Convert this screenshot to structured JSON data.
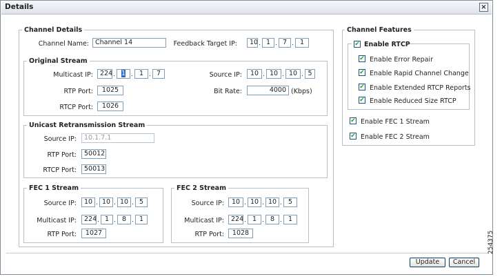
{
  "dialog": {
    "title": "Details",
    "close_glyph": "×"
  },
  "channel_details": {
    "legend": "Channel Details",
    "channel_name_label": "Channel Name:",
    "channel_name": "Channel 14",
    "feedback_label": "Feedback Target IP:",
    "feedback_ip": [
      "10",
      "1",
      "7",
      "1"
    ]
  },
  "original_stream": {
    "legend": "Original Stream",
    "multicast_label": "Multicast IP:",
    "multicast_ip": [
      "224",
      "1",
      "1",
      "7"
    ],
    "source_label": "Source IP:",
    "source_ip": [
      "10",
      "10",
      "10",
      "5"
    ],
    "rtp_label": "RTP Port:",
    "rtp_port": "1025",
    "bitrate_label": "Bit Rate:",
    "bitrate": "4000",
    "bitrate_unit": "(Kbps)",
    "rtcp_label": "RTCP Port:",
    "rtcp_port": "1026"
  },
  "unicast_stream": {
    "legend": "Unicast Retransmission Stream",
    "source_label": "Source IP:",
    "source_ip": "10.1.7.1",
    "rtp_label": "RTP Port:",
    "rtp_port": "50012",
    "rtcp_label": "RTCP Port:",
    "rtcp_port": "50013"
  },
  "fec1": {
    "legend": "FEC 1 Stream",
    "source_label": "Source IP:",
    "source_ip": [
      "10",
      "10",
      "10",
      "5"
    ],
    "multicast_label": "Multicast IP:",
    "multicast_ip": [
      "224",
      "1",
      "8",
      "1"
    ],
    "rtp_label": "RTP Port:",
    "rtp_port": "1027"
  },
  "fec2": {
    "legend": "FEC 2 Stream",
    "source_label": "Source IP:",
    "source_ip": [
      "10",
      "10",
      "10",
      "5"
    ],
    "multicast_label": "Multicast IP:",
    "multicast_ip": [
      "224",
      "1",
      "8",
      "1"
    ],
    "rtp_label": "RTP Port:",
    "rtp_port": "1028"
  },
  "channel_features": {
    "legend": "Channel Features",
    "enable_rtcp": {
      "label": "Enable RTCP",
      "checked": true
    },
    "rtcp_options": [
      {
        "label": "Enable Error Repair",
        "checked": true
      },
      {
        "label": "Enable Rapid Channel Change",
        "checked": true
      },
      {
        "label": "Enable Extended RTCP Reports",
        "checked": true
      },
      {
        "label": "Enable Reduced Size RTCP",
        "checked": true
      }
    ],
    "fec1": {
      "label": "Enable FEC 1 Stream",
      "checked": true
    },
    "fec2": {
      "label": "Enable FEC 2 Stream",
      "checked": true
    },
    "check_glyph": "✔"
  },
  "buttons": {
    "update": "Update",
    "cancel": "Cancel"
  },
  "figure_number": "254375",
  "ip_separator": "."
}
